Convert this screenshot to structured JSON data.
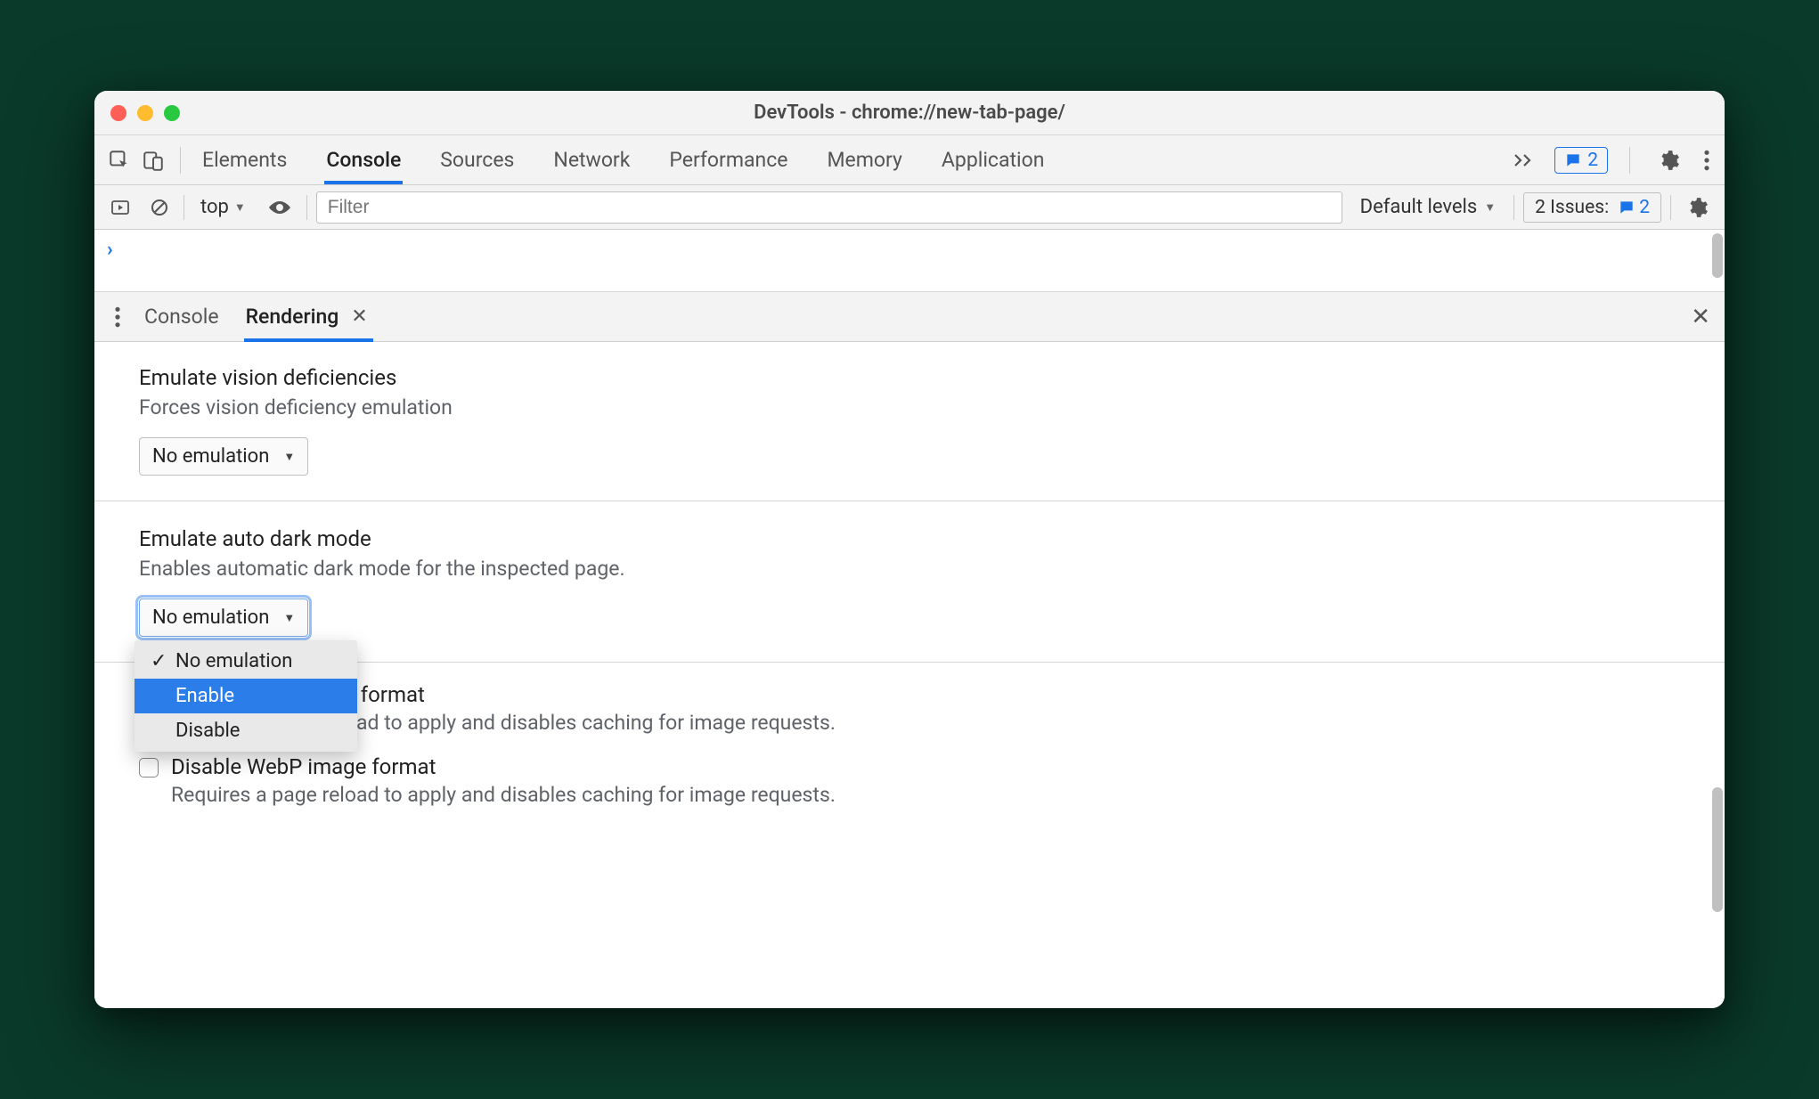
{
  "window": {
    "title": "DevTools - chrome://new-tab-page/"
  },
  "tabstrip": {
    "tabs": [
      "Elements",
      "Console",
      "Sources",
      "Network",
      "Performance",
      "Memory",
      "Application"
    ],
    "active_index": 1,
    "badge_count": "2"
  },
  "console_toolbar": {
    "context": "top",
    "filter_placeholder": "Filter",
    "levels_label": "Default levels",
    "issues_label": "2 Issues:",
    "issues_count": "2"
  },
  "drawer": {
    "tabs": [
      "Console",
      "Rendering"
    ],
    "active_index": 1
  },
  "rendering": {
    "vision": {
      "title": "Emulate vision deficiencies",
      "sub": "Forces vision deficiency emulation",
      "value": "No emulation"
    },
    "darkmode": {
      "title": "Emulate auto dark mode",
      "sub": "Enables automatic dark mode for the inspected page.",
      "value": "No emulation",
      "options": [
        "No emulation",
        "Enable",
        "Disable"
      ],
      "highlight_index": 1,
      "checked_index": 0
    },
    "avif": {
      "title": "Disable AVIF image format",
      "sub": "Requires a page reload to apply and disables caching for image requests."
    },
    "webp": {
      "title": "Disable WebP image format",
      "sub": "Requires a page reload to apply and disables caching for image requests."
    }
  }
}
